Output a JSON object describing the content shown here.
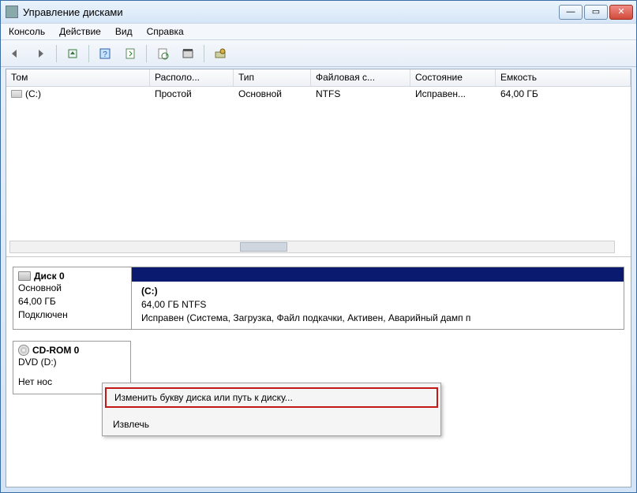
{
  "window": {
    "title": "Управление дисками"
  },
  "menubar": {
    "items": [
      "Консоль",
      "Действие",
      "Вид",
      "Справка"
    ]
  },
  "columns": {
    "c0": "Том",
    "c1": "Располо...",
    "c2": "Тип",
    "c3": "Файловая с...",
    "c4": "Состояние",
    "c5": "Емкость"
  },
  "volume": {
    "name": "(C:)",
    "layout": "Простой",
    "type": "Основной",
    "fs": "NTFS",
    "status": "Исправен...",
    "capacity": "64,00 ГБ"
  },
  "disk0": {
    "title": "Диск 0",
    "type": "Основной",
    "capacity": "64,00 ГБ",
    "state": "Подключен",
    "part_vol": "(C:)",
    "part_cap": "64,00 ГБ NTFS",
    "part_status": "Исправен (Система, Загрузка, Файл подкачки, Активен, Аварийный дамп п"
  },
  "cdrom": {
    "title": "CD-ROM 0",
    "drv": "DVD (D:)",
    "state": "Нет нос"
  },
  "ctx": {
    "change_letter": "Изменить букву диска или путь к диску...",
    "eject": "Извлечь"
  }
}
